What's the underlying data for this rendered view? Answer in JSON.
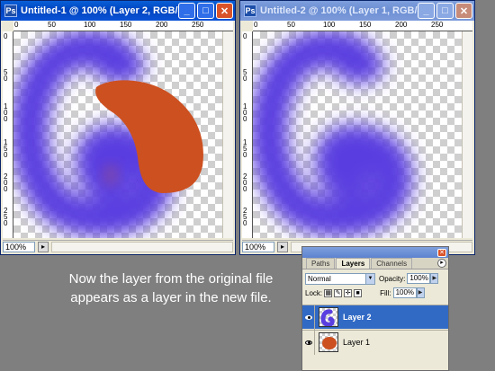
{
  "window1": {
    "title": "Untitled-1 @ 100% (Layer 2, RGB/8)",
    "zoom": "100%",
    "ruler_top": [
      "0",
      "50",
      "100",
      "150",
      "200",
      "250"
    ],
    "ruler_left": [
      "0",
      "50",
      "100",
      "150",
      "200",
      "250"
    ]
  },
  "window2": {
    "title": "Untitled-2 @ 100% (Layer 1, RGB/8)",
    "zoom": "100%",
    "ruler_top": [
      "0",
      "50",
      "100",
      "150",
      "200",
      "250"
    ],
    "ruler_left": [
      "0",
      "50",
      "100",
      "150",
      "200",
      "250"
    ]
  },
  "caption": {
    "line1": "Now the layer from the original file",
    "line2": "appears  as a layer in the new file."
  },
  "layers_palette": {
    "tabs": [
      "Paths",
      "Layers",
      "Channels"
    ],
    "active_tab": "Layers",
    "blend_mode": "Normal",
    "opacity_label": "Opacity:",
    "opacity_value": "100%",
    "lock_label": "Lock:",
    "fill_label": "Fill:",
    "fill_value": "100%",
    "layers": [
      {
        "name": "Layer 2",
        "selected": true,
        "visible": true
      },
      {
        "name": "Layer 1",
        "selected": false,
        "visible": true
      }
    ]
  },
  "colors": {
    "purple_paint": "#5a3ee0",
    "orange_paint": "#cd5020",
    "active_titlebar": "#0a5fd8",
    "inactive_titlebar": "#7e9fdc",
    "selected_layer": "#316ac5",
    "background": "#7f7f7f"
  }
}
